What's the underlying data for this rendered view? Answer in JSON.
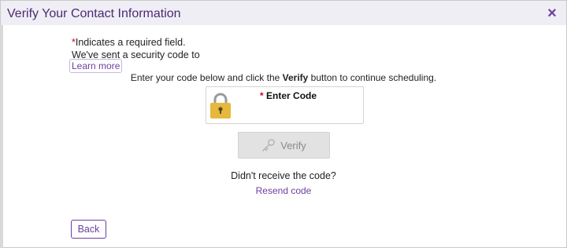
{
  "dialog": {
    "title": "Verify Your Contact Information",
    "close_label": "×"
  },
  "form": {
    "required_marker": "*",
    "required_note": "Indicates a required field.",
    "sent_note": "We've sent a security code to",
    "learn_more": "Learn more",
    "instruction_before": "Enter your code below and click the ",
    "instruction_bold": "Verify",
    "instruction_after": " button to continue scheduling.",
    "code_label": "Enter Code",
    "code_value": ""
  },
  "actions": {
    "verify_label": "Verify",
    "didnt_receive": "Didn't receive the code?",
    "resend_label": "Resend code",
    "back_label": "Back"
  },
  "colors": {
    "accent": "#6b3f9e",
    "title": "#4b2a73",
    "required": "#d0021b",
    "lock": "#e6b83d"
  },
  "icons": {
    "close": "close-icon",
    "lock": "lock-icon",
    "key": "key-icon"
  }
}
